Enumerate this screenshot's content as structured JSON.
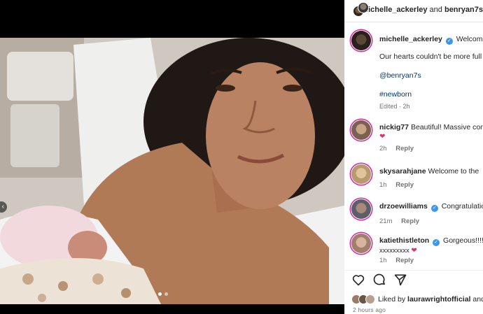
{
  "header": {
    "user1": "michelle_ackerley",
    "connector": "and",
    "user2": "benryan7s"
  },
  "caption": {
    "username": "michelle_ackerley",
    "text_start": "Welcome t",
    "line2": "Our hearts couldn't be more full",
    "mention": "@benryan7s",
    "hashtag": "#newborn",
    "edited": "Edited · 2h"
  },
  "comments": [
    {
      "username": "nickig77",
      "verified": false,
      "text": "Beautiful! Massive cong",
      "extra": "❤",
      "time": "2h",
      "reply": "Reply"
    },
    {
      "username": "skysarahjane",
      "verified": false,
      "text": "Welcome to the",
      "extra": "",
      "time": "1h",
      "reply": "Reply"
    },
    {
      "username": "drzoewilliams",
      "verified": true,
      "text": "Congratulation",
      "extra": "",
      "time": "21m",
      "reply": "Reply"
    },
    {
      "username": "katiethistleton",
      "verified": true,
      "text": "Gorgeous!!!! C",
      "extra": "xxxxxxxxx",
      "time": "1h",
      "reply": "Reply"
    }
  ],
  "actions": {
    "like_icon": "heart-outline-icon",
    "comment_icon": "comment-icon",
    "share_icon": "paper-plane-icon"
  },
  "likes": {
    "prefix": "Liked by",
    "user": "laurawrightofficial",
    "suffix": "and"
  },
  "time_ago": "2 hours ago",
  "colors": {
    "link": "#00376b",
    "verified": "#3897f0",
    "story_ring": "#d6249f",
    "secondary_text": "#737373"
  }
}
